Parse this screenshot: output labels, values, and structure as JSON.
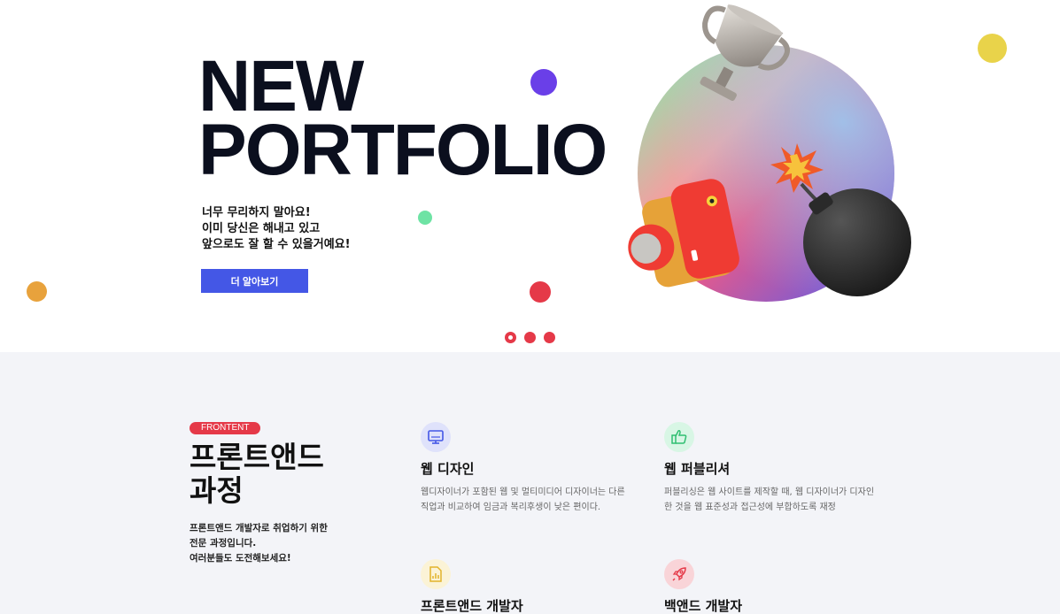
{
  "hero": {
    "title_line1": "NEW",
    "title_line2": "PORTFOLIO",
    "desc": [
      "너무 무리하지 말아요!",
      "이미 당신은 해내고 있고",
      "앞으로도 잘 할 수 있을거예요!"
    ],
    "cta_label": "더 알아보기"
  },
  "colors": {
    "accent_blue": "#4457e6",
    "accent_red": "#e53948",
    "purple_dot": "#6a3fe8",
    "green_dot": "#6ee3a4",
    "orange_dot": "#e8a23c",
    "yellow_dot": "#e9d34a"
  },
  "slider": {
    "pages": 3,
    "active": 1
  },
  "section": {
    "badge": "FRONTENT",
    "title": [
      "프론트앤드",
      "과정"
    ],
    "desc": [
      "프론트앤드 개발자로 취업하기 위한",
      "전문 과정입니다.",
      "여러분들도 도전해보세요!"
    ],
    "cards": [
      {
        "icon": "monitor-icon",
        "title": "웹 디자인",
        "text": "웹디자이너가 포함된 웹 및 멀티미디어 디자이너는 다른 직업과 비교하여 임금과 복리후생이 낮은 편이다."
      },
      {
        "icon": "thumbs-up-icon",
        "title": "웹 퍼블리셔",
        "text": "퍼블리싱은 웹 사이트를 제작할 때, 웹 디자이너가 디자인한 것을 웹 표준성과 접근성에 부합하도록 재정"
      },
      {
        "icon": "document-chart-icon",
        "title": "프론트앤드 개발자",
        "text": ""
      },
      {
        "icon": "rocket-icon",
        "title": "백앤드 개발자",
        "text": ""
      }
    ]
  }
}
